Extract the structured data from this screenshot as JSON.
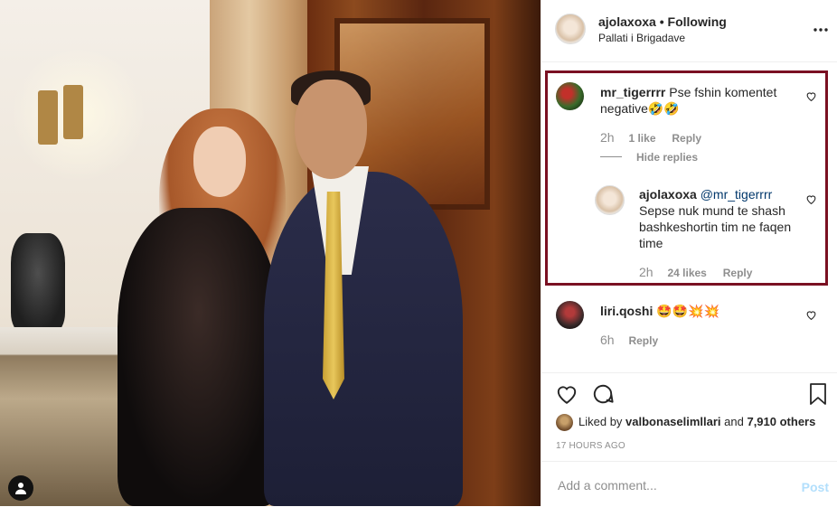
{
  "header": {
    "username": "ajolaxoxa",
    "separator": " • ",
    "follow_status": "Following",
    "location": "Pallati i Brigadave",
    "more_icon": "more-horizontal-icon"
  },
  "comments": [
    {
      "username": "mr_tigerrrr",
      "text": "Pse fshin komentet negative🤣🤣",
      "time": "2h",
      "likes": "1 like",
      "reply_label": "Reply",
      "hide_replies_label": "Hide replies",
      "replies": [
        {
          "username": "ajolaxoxa",
          "mention": "@mr_tigerrrr",
          "text": "Sepse nuk mund te shash bashkeshortin tim ne faqen time",
          "time": "2h",
          "likes": "24 likes",
          "reply_label": "Reply"
        }
      ]
    },
    {
      "username": "liri.qoshi",
      "text": "🤩🤩💥💥",
      "time": "6h",
      "reply_label": "Reply"
    }
  ],
  "actions": {
    "like_icon": "heart-icon",
    "comment_icon": "comment-icon",
    "save_icon": "bookmark-icon"
  },
  "likes": {
    "prefix": "Liked by ",
    "user": "valbonaselimllari",
    "middle": " and ",
    "others": "7,910 others"
  },
  "timestamp": "17 HOURS AGO",
  "comment_box": {
    "placeholder": "Add a comment...",
    "post_label": "Post"
  },
  "colors": {
    "highlight_border": "#7a1022",
    "post_button": "#b2dffc",
    "mention": "#00376b"
  }
}
